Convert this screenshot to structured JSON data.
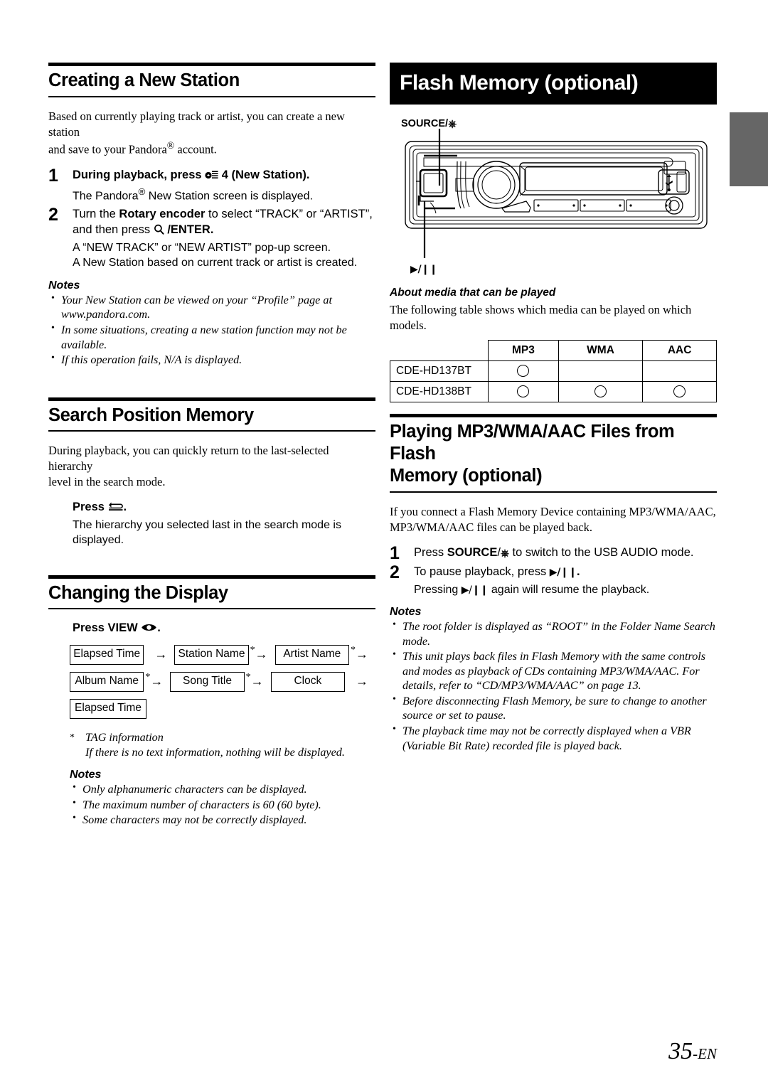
{
  "edge_tab_color": "#666666",
  "left_column": {
    "section1": {
      "heading": "Creating a New Station",
      "intro_line1": "Based on currently playing track or artist, you can create a new station",
      "intro_line2_a": "and save to your Pandora",
      "intro_line2_b": " account.",
      "steps": [
        {
          "num": "1",
          "title_a": "During playback, press ",
          "title_b": " 4 (New Station).",
          "body_a": "The Pandora",
          "body_b": " New Station screen is displayed."
        },
        {
          "num": "2",
          "title_a": "Turn the ",
          "title_bold": "Rotary encoder",
          "title_b": " to select “TRACK” or “ARTIST”,",
          "title_line2_a": "and then press ",
          "title_line2_b": " /ENTER.",
          "body_line1": "A “NEW TRACK” or “NEW ARTIST” pop-up screen.",
          "body_line2": "A New Station based on current track or artist is created."
        }
      ],
      "notes_title": "Notes",
      "notes": [
        "Your New Station can be viewed on your “Profile” page at www.pandora.com.",
        "In some situations, creating a new station function may not be available.",
        "If this operation fails, N/A is displayed."
      ]
    },
    "section2": {
      "heading": "Search Position Memory",
      "intro_line1": "During playback, you can quickly return to the last-selected hierarchy",
      "intro_line2": "level in the search mode.",
      "step_title_a": "Press ",
      "step_title_b": ".",
      "step_body": "The hierarchy you selected last in the search mode is displayed."
    },
    "section3": {
      "heading": "Changing the Display",
      "step_title_a": "Press VIEW ",
      "step_title_b": ".",
      "flow": {
        "row1": [
          {
            "label": "Elapsed Time",
            "star": false,
            "arrow": true
          },
          {
            "label": "Station Name",
            "star": true,
            "arrow": true
          },
          {
            "label": "Artist Name",
            "star": true,
            "arrow": true
          }
        ],
        "row2": [
          {
            "label": "Album Name",
            "star": true,
            "arrow": true
          },
          {
            "label": "Song Title",
            "star": true,
            "arrow": true
          },
          {
            "label": "Clock",
            "star": false,
            "arrow": true
          }
        ],
        "row3": [
          {
            "label": "Elapsed Time",
            "star": false,
            "arrow": false
          }
        ]
      },
      "footnote_marker": "*",
      "footnote_line1": "TAG information",
      "footnote_line2": "If there is no text information, nothing will be displayed.",
      "notes_title": "Notes",
      "notes": [
        "Only alphanumeric characters can be displayed.",
        "The maximum number of characters is 60 (60 byte).",
        "Some characters may not be correctly displayed."
      ]
    }
  },
  "right_column": {
    "banner_heading": "Flash Memory (optional)",
    "figure": {
      "source_label_a": "SOURCE/",
      "play_label": "▶/▐▐"
    },
    "media_section": {
      "sub_heading": "About media that can be played",
      "intro": "The following table shows which media can be played on which models.",
      "table": {
        "columns": [
          "",
          "MP3",
          "WMA",
          "AAC"
        ],
        "rows": [
          {
            "model": "CDE-HD137BT",
            "cells": [
              true,
              false,
              false
            ]
          },
          {
            "model": "CDE-HD138BT",
            "cells": [
              true,
              true,
              true
            ]
          }
        ]
      }
    },
    "section2": {
      "heading_line1": "Playing MP3/WMA/AAC Files from Flash",
      "heading_line2": "Memory (optional)",
      "intro_line1": "If you connect a Flash Memory Device containing MP3/WMA/AAC,",
      "intro_line2": "MP3/WMA/AAC files can be played back.",
      "steps": [
        {
          "num": "1",
          "title_a": "Press ",
          "title_bold": "SOURCE",
          "title_mid": "/",
          "title_b": " to switch to the USB AUDIO mode."
        },
        {
          "num": "2",
          "title_a": "To pause playback, press ",
          "title_b": ".",
          "body_a": "Pressing ",
          "body_b": " again will resume the playback."
        }
      ],
      "notes_title": "Notes",
      "notes": [
        "The root folder is displayed as “ROOT” in the Folder Name Search mode.",
        "This unit plays back files in Flash Memory with the same controls and modes as playback of CDs containing MP3/WMA/AAC. For details, refer to “CD/MP3/WMA/AAC” on page 13.",
        "Before disconnecting Flash Memory, be sure to change to another source or set to pause.",
        "The playback time may not be correctly displayed when a VBR (Variable Bit Rate) recorded file is played back."
      ]
    }
  },
  "footer": {
    "page_number": "35",
    "language_suffix": "-EN"
  }
}
